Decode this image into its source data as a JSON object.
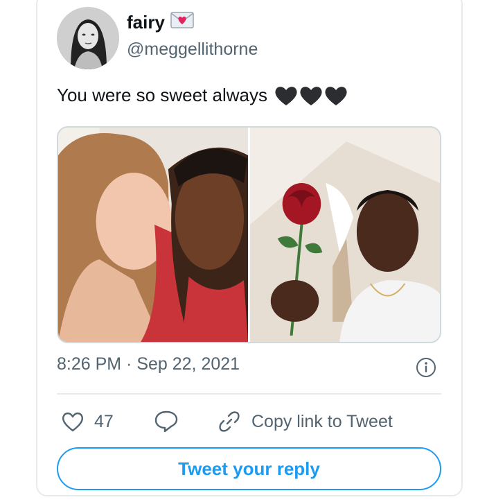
{
  "user": {
    "display_name": "fairy",
    "name_emoji_icon": "love-letter-icon",
    "handle": "@meggellithorne"
  },
  "tweet": {
    "text": "You were so sweet always",
    "emoji_icons": [
      "black-heart-icon",
      "black-heart-icon",
      "black-heart-icon"
    ],
    "timestamp": "8:26 PM · Sep 22, 2021"
  },
  "actions": {
    "like_count": "47",
    "copy_link_label": "Copy link to Tweet"
  },
  "reply_button_label": "Tweet your reply",
  "colors": {
    "accent": "#1d9bf0",
    "text_primary": "#0f1419",
    "text_secondary": "#536471",
    "border": "#cfd9de"
  }
}
